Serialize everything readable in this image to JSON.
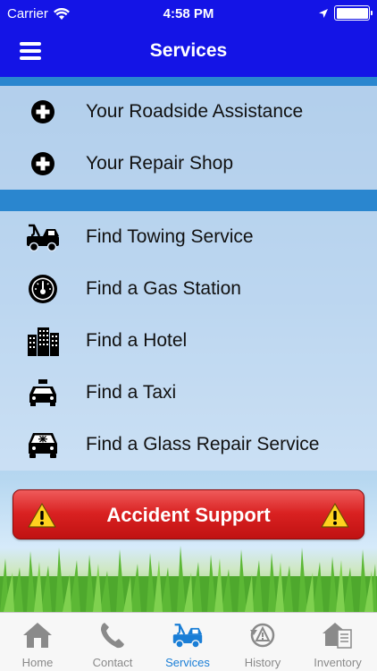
{
  "status": {
    "carrier": "Carrier",
    "time": "4:58 PM"
  },
  "header": {
    "title": "Services"
  },
  "sections": [
    {
      "items": [
        {
          "label": "Your Roadside Assistance",
          "icon": "plus-circle-icon"
        },
        {
          "label": "Your Repair Shop",
          "icon": "plus-circle-icon"
        }
      ]
    },
    {
      "items": [
        {
          "label": "Find Towing Service",
          "icon": "tow-truck-icon"
        },
        {
          "label": "Find a Gas Station",
          "icon": "gauge-icon"
        },
        {
          "label": "Find a Hotel",
          "icon": "hotel-icon"
        },
        {
          "label": "Find a Taxi",
          "icon": "taxi-icon"
        },
        {
          "label": "Find a Glass Repair Service",
          "icon": "car-glass-icon"
        }
      ]
    }
  ],
  "accident": {
    "label": "Accident Support"
  },
  "tabs": [
    {
      "label": "Home",
      "icon": "home-icon"
    },
    {
      "label": "Contact",
      "icon": "phone-icon"
    },
    {
      "label": "Services",
      "icon": "tow-truck-icon",
      "active": true
    },
    {
      "label": "History",
      "icon": "history-icon"
    },
    {
      "label": "Inventory",
      "icon": "inventory-icon"
    }
  ],
  "colors": {
    "header": "#1414e6",
    "accent": "#1a7ed6",
    "alert": "#d92121"
  }
}
